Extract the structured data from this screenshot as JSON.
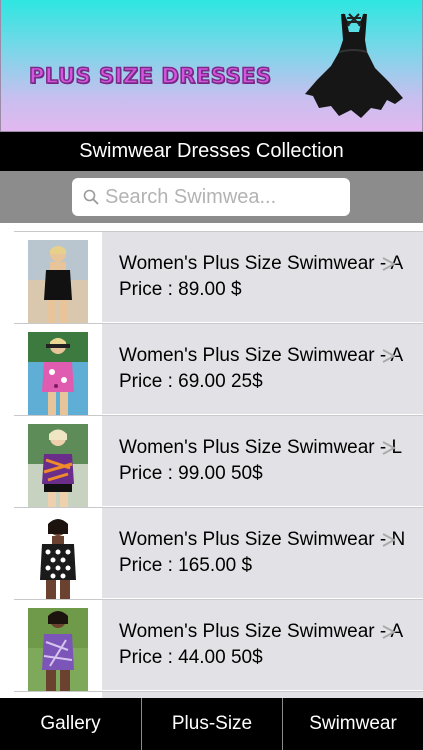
{
  "banner": {
    "title": "PLUS SIZE DRESSES",
    "image": "black-dress-illustration"
  },
  "header": {
    "title": "Swimwear Dresses Collection"
  },
  "search": {
    "placeholder": "Search Swimwea..."
  },
  "products": [
    {
      "title": "Women's Plus Size Swimwear - A",
      "price": "Price : 89.00 $",
      "image": "swimwear-photo-black-tankini"
    },
    {
      "title": "Women's Plus Size Swimwear - A",
      "price": "Price : 69.00 25$",
      "image": "swimwear-photo-pink-print-tankini"
    },
    {
      "title": "Women's Plus Size Swimwear - L",
      "price": "Price : 99.00 50$",
      "image": "swimwear-photo-purple-print-tankini"
    },
    {
      "title": "Women's Plus Size Swimwear - N",
      "price": "Price : 165.00 $",
      "image": "swimwear-photo-black-white-dot-swimsuit"
    },
    {
      "title": "Women's Plus Size Swimwear - A",
      "price": "Price : 44.00 50$",
      "image": "swimwear-photo-purple-print-swimsuit"
    }
  ],
  "tabs": [
    {
      "label": "Gallery"
    },
    {
      "label": "Plus-Size"
    },
    {
      "label": "Swimwear"
    }
  ],
  "colors": {
    "banner_top": "#2ee6e0",
    "banner_bottom": "#e2b8ef",
    "title_pink": "#d455e0",
    "bar_black": "#000000",
    "search_bar_gray": "#8c8c8c",
    "row_bg": "#e2e2e6"
  }
}
